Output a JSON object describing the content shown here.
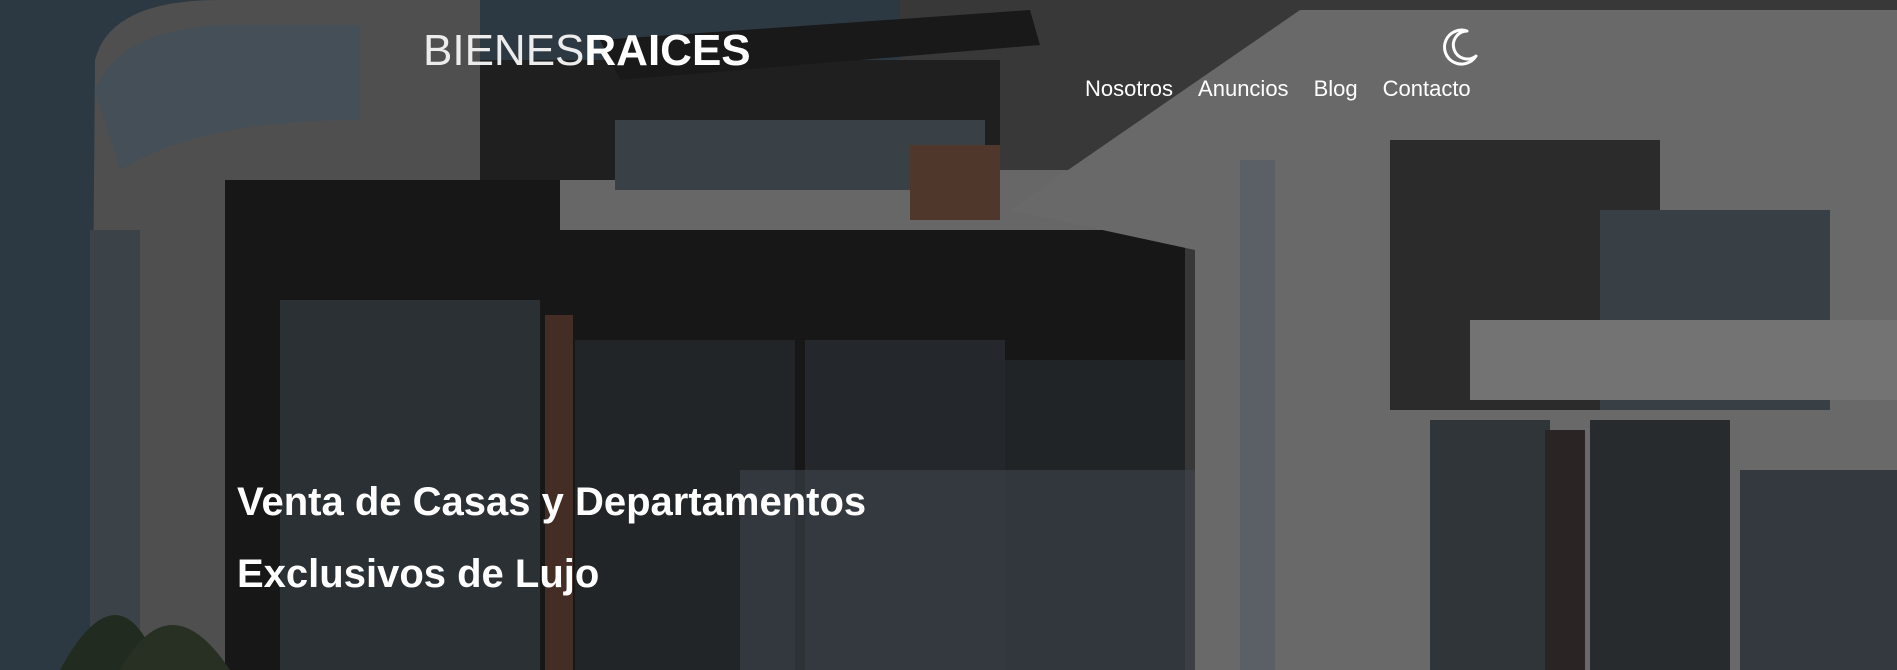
{
  "header": {
    "logo_light": "BIENES",
    "logo_bold": "RAICES",
    "theme_toggle_icon": "moon-icon"
  },
  "nav": {
    "items": [
      {
        "label": "Nosotros"
      },
      {
        "label": "Anuncios"
      },
      {
        "label": "Blog"
      },
      {
        "label": "Contacto"
      }
    ]
  },
  "hero": {
    "line1": "Venta de Casas y Departamentos",
    "line2": "Exclusivos de Lujo",
    "background": "modern-house-photo"
  },
  "colors": {
    "text": "#ffffff",
    "overlay": "#000000"
  }
}
